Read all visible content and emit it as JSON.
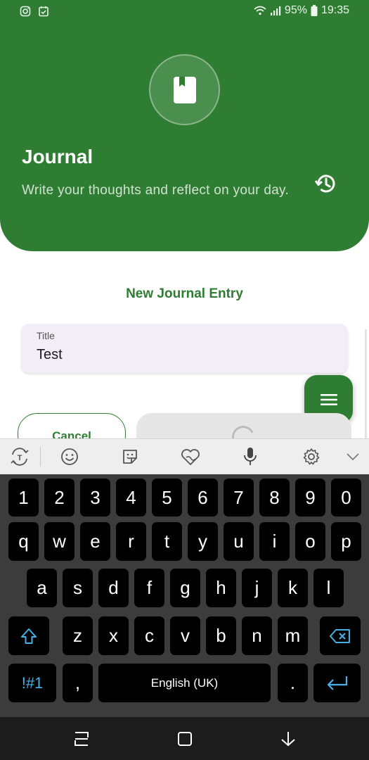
{
  "status_bar": {
    "left_icons": [
      "instagram-icon",
      "calendar-check-icon"
    ],
    "battery": "95%",
    "time": "19:35"
  },
  "header": {
    "icon": "book-icon",
    "title": "Journal",
    "subtitle": "Write your thoughts and reflect on your day.",
    "history_icon": "history-icon"
  },
  "form": {
    "heading": "New Journal Entry",
    "title_label": "Title",
    "title_value": "Test",
    "cancel_label": "Cancel"
  },
  "fab": {
    "icon": "menu-icon"
  },
  "keyboard_toolbar": [
    "text-recognition-icon",
    "emoji-icon",
    "sticker-icon",
    "heart-sticker-icon",
    "microphone-icon",
    "settings-icon",
    "chevron-down-icon"
  ],
  "keyboard": {
    "row_numbers": [
      "1",
      "2",
      "3",
      "4",
      "5",
      "6",
      "7",
      "8",
      "9",
      "0"
    ],
    "row_1": [
      "q",
      "w",
      "e",
      "r",
      "t",
      "y",
      "u",
      "i",
      "o",
      "p"
    ],
    "row_2": [
      "a",
      "s",
      "d",
      "f",
      "g",
      "h",
      "j",
      "k",
      "l"
    ],
    "row_3": [
      "z",
      "x",
      "c",
      "v",
      "b",
      "n",
      "m"
    ],
    "symbols_label": "!#1",
    "comma": ",",
    "space_label": "English (UK)",
    "period": "."
  },
  "nav_bar": [
    "recent-apps-icon",
    "home-icon",
    "back-icon"
  ],
  "colors": {
    "primary": "#2e7d32",
    "field_bg": "#f3edf7",
    "keyboard_bg": "#3c3c3c",
    "key_bg": "#000000",
    "accent_key": "#46b1e6"
  }
}
